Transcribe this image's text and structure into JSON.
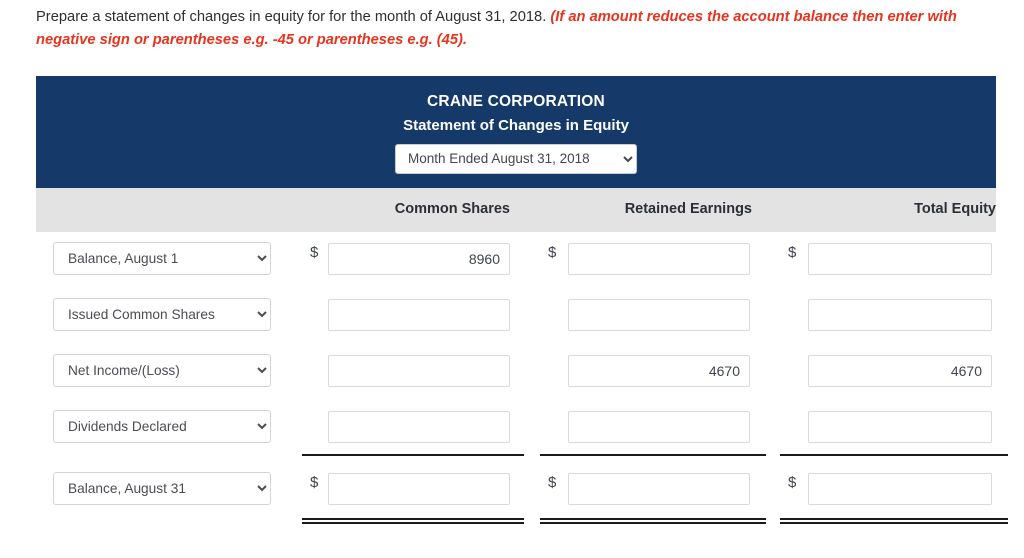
{
  "instructions": {
    "plain": "Prepare a statement of changes in equity for for the month of August 31, 2018.",
    "note": "(If an amount reduces the account balance then enter with negative sign or parentheses e.g. -45 or parentheses e.g. (45)."
  },
  "statement": {
    "company_name": "CRANE CORPORATION",
    "title": "Statement of Changes in Equity",
    "period": {
      "selected": "Month Ended August 31, 2018",
      "options": [
        "Month Ended August 31, 2018"
      ]
    },
    "columns": [
      {
        "label": "Common Shares"
      },
      {
        "label": "Retained Earnings"
      },
      {
        "label": "Total Equity"
      }
    ],
    "rows": [
      {
        "line_item": "Balance, August 1",
        "line_item_options": [
          "Balance, August 1"
        ],
        "show_dollar": true,
        "common_shares": "8960",
        "retained_earnings": "",
        "total_equity": ""
      },
      {
        "line_item": "Issued Common Shares",
        "line_item_options": [
          "Issued Common Shares"
        ],
        "show_dollar": false,
        "common_shares": "",
        "retained_earnings": "",
        "total_equity": ""
      },
      {
        "line_item": "Net Income/(Loss)",
        "line_item_options": [
          "Net Income/(Loss)"
        ],
        "show_dollar": false,
        "common_shares": "",
        "retained_earnings": "4670",
        "total_equity": "4670"
      },
      {
        "line_item": "Dividends Declared",
        "line_item_options": [
          "Dividends Declared"
        ],
        "show_dollar": false,
        "common_shares": "",
        "retained_earnings": "",
        "total_equity": ""
      },
      {
        "line_item": "Balance, August 31",
        "line_item_options": [
          "Balance, August 31"
        ],
        "show_dollar": true,
        "common_shares": "",
        "retained_earnings": "",
        "total_equity": ""
      }
    ],
    "colors": {
      "header_bg": "#153968",
      "column_header_bg": "#e3e3e3",
      "note_text": "#e8341f"
    }
  }
}
